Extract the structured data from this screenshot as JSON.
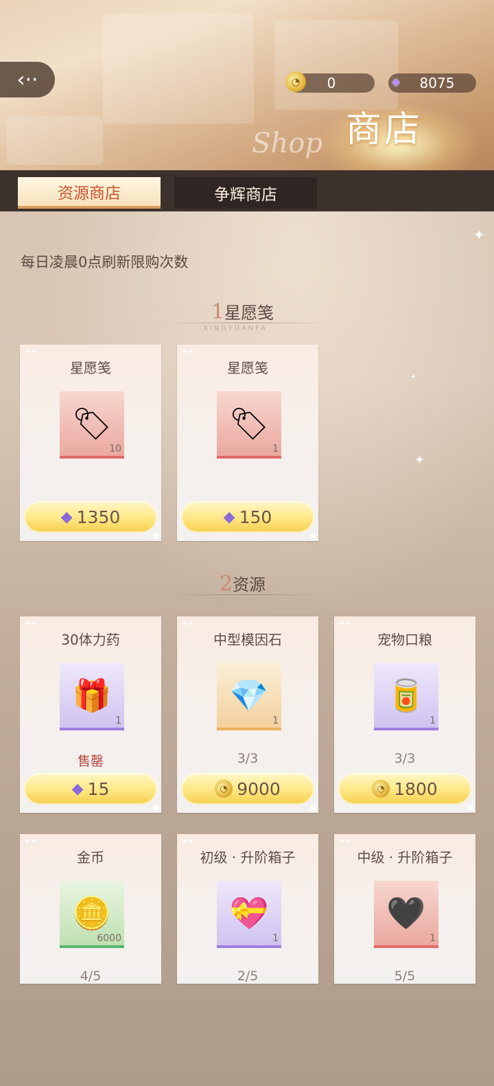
{
  "header": {
    "back_icon": "back-arrow-icon",
    "title": "商店",
    "title_en": "Shop",
    "currency": {
      "coins": "0",
      "gems": "8075"
    }
  },
  "tabs": [
    {
      "label": "资源商店",
      "active": true
    },
    {
      "label": "争辉商店",
      "active": false
    }
  ],
  "notice": "每日凌晨0点刷新限购次数",
  "sections": [
    {
      "index": "1",
      "title": "星愿笺",
      "subtitle": "XINGYUANFA",
      "items": [
        {
          "name": "星愿笺",
          "qty": "10",
          "icon": "wish-tag-icon",
          "price": "1350",
          "currency": "gem",
          "status": ""
        },
        {
          "name": "星愿笺",
          "qty": "1",
          "icon": "wish-tag-icon",
          "price": "150",
          "currency": "gem",
          "status": ""
        }
      ]
    },
    {
      "index": "2",
      "title": "资源",
      "subtitle": "ZIYUAN",
      "items": [
        {
          "name": "30体力药",
          "qty": "1",
          "icon": "cake-box-icon",
          "price": "15",
          "currency": "gem",
          "status": "售罄"
        },
        {
          "name": "中型模因石",
          "qty": "1",
          "icon": "crystal-cube-icon",
          "price": "9000",
          "currency": "coin",
          "status": "3/3"
        },
        {
          "name": "宠物口粮",
          "qty": "1",
          "icon": "pet-food-can-icon",
          "price": "1800",
          "currency": "coin",
          "status": "3/3"
        },
        {
          "name": "金币",
          "qty": "6000",
          "icon": "gold-coin-icon",
          "status": "4/5"
        },
        {
          "name": "初级 · 升阶箱子",
          "qty": "1",
          "icon": "heart-chocolate-box-icon",
          "status": "2/5"
        },
        {
          "name": "中级 · 升阶箱子",
          "qty": "1",
          "icon": "dark-heart-chocolate-box-icon",
          "status": "5/5"
        }
      ]
    }
  ]
}
